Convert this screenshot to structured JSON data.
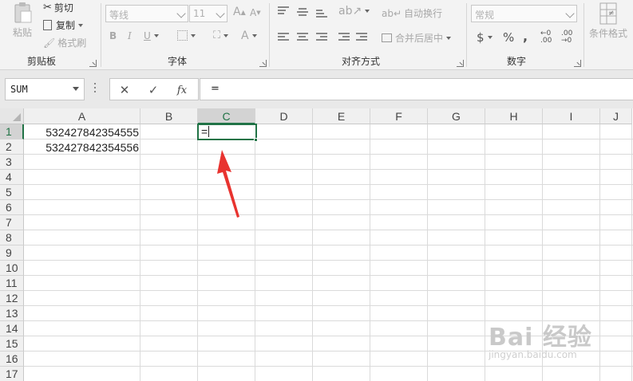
{
  "ribbon": {
    "clipboard": {
      "paste_label": "粘贴",
      "cut_label": "剪切",
      "copy_label": "复制",
      "format_painter_label": "格式刷",
      "group_label": "剪贴板"
    },
    "font": {
      "font_name": "等线",
      "font_size": "11",
      "bold": "B",
      "italic": "I",
      "underline": "U",
      "grow_font": "A",
      "shrink_font": "A",
      "font_color": "A",
      "group_label": "字体"
    },
    "alignment": {
      "wrap_text_label": "自动换行",
      "merge_center_label": "合并后居中",
      "group_label": "对齐方式"
    },
    "number": {
      "format": "常规",
      "currency": "$",
      "percent": "%",
      "comma": ",",
      "inc_decimal": "←0 .00",
      "dec_decimal": ".00 →0",
      "group_label": "数字"
    },
    "styles": {
      "conditional_format_label": "条件格式"
    }
  },
  "formula_bar": {
    "name_box": "SUM",
    "cancel_icon": "✕",
    "enter_icon": "✓",
    "fx_label": "fx",
    "formula": "="
  },
  "grid": {
    "columns": [
      "A",
      "B",
      "C",
      "D",
      "E",
      "F",
      "G",
      "H",
      "I",
      "J"
    ],
    "rows": [
      "1",
      "2",
      "3",
      "4",
      "5",
      "6",
      "7",
      "8",
      "9",
      "10",
      "11",
      "12",
      "13",
      "14",
      "15",
      "16",
      "17"
    ],
    "active_column": "C",
    "active_row": "1",
    "cells": {
      "A1": "532427842354555",
      "A2": "532427842354556",
      "C1": "="
    }
  },
  "watermark": {
    "text": "Bai 经验",
    "url": "jingyan.baidu.com"
  },
  "colors": {
    "accent": "#217346",
    "arrow": "#e8332f"
  }
}
